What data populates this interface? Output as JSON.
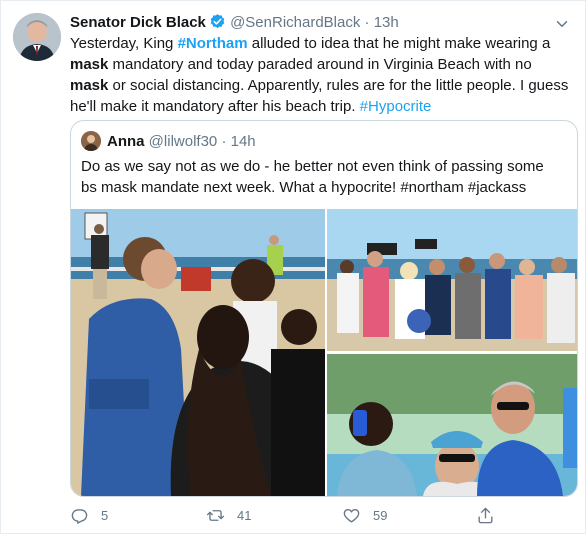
{
  "tweet": {
    "author_name": "Senator Dick Black",
    "author_handle": "@SenRichardBlack",
    "separator": "·",
    "time": "13h",
    "text_parts": {
      "p1": "Yesterday, King ",
      "h1": "#Northam",
      "p2": " alluded to idea that he might make wearing a ",
      "b1": "mask",
      "p3": " mandatory and today paraded around in Virginia Beach with no ",
      "b2": "mask",
      "p4": " or social distancing.  Apparently, rules are for the little people.  I guess he'll make it mandatory after his beach trip.  ",
      "h2": "#Hypocrite"
    }
  },
  "quoted": {
    "author_name": "Anna",
    "author_handle": "@lilwolf30",
    "separator": "·",
    "time": "14h",
    "text": "Do as we say not as we do - he better not even think of passing some bs mask mandate next week. What a hypocrite! #northam #jackass"
  },
  "actions": {
    "reply_count": "5",
    "retweet_count": "41",
    "like_count": "59",
    "reply_icon": "reply-icon",
    "retweet_icon": "retweet-icon",
    "like_icon": "heart-icon",
    "share_icon": "share-icon"
  },
  "colors": {
    "accent": "#1da1f2",
    "secondary_text": "#657786",
    "border": "#e6ecf0"
  }
}
